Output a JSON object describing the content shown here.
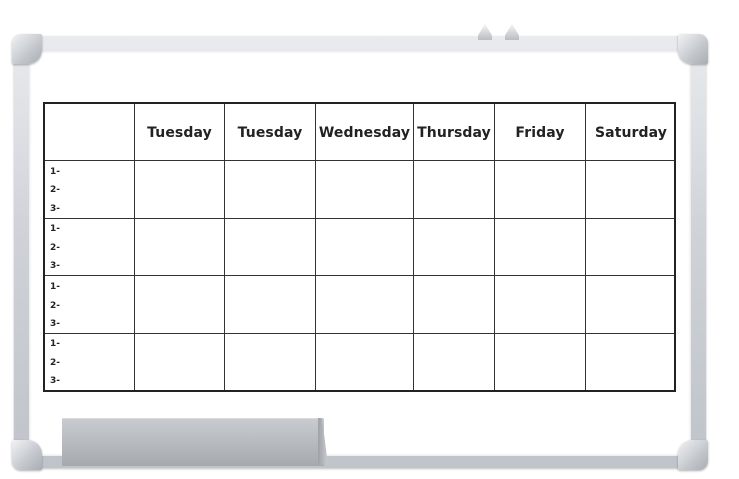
{
  "planner": {
    "columns": [
      "Tuesday",
      "Tuesday",
      "Wednesday",
      "Thursday",
      "Friday",
      "Saturday"
    ],
    "row_slots": [
      [
        "1-",
        "2-",
        "3-"
      ],
      [
        "1-",
        "2-",
        "3-"
      ],
      [
        "1-",
        "2-",
        "3-"
      ],
      [
        "1-",
        "2-",
        "3-"
      ]
    ]
  }
}
